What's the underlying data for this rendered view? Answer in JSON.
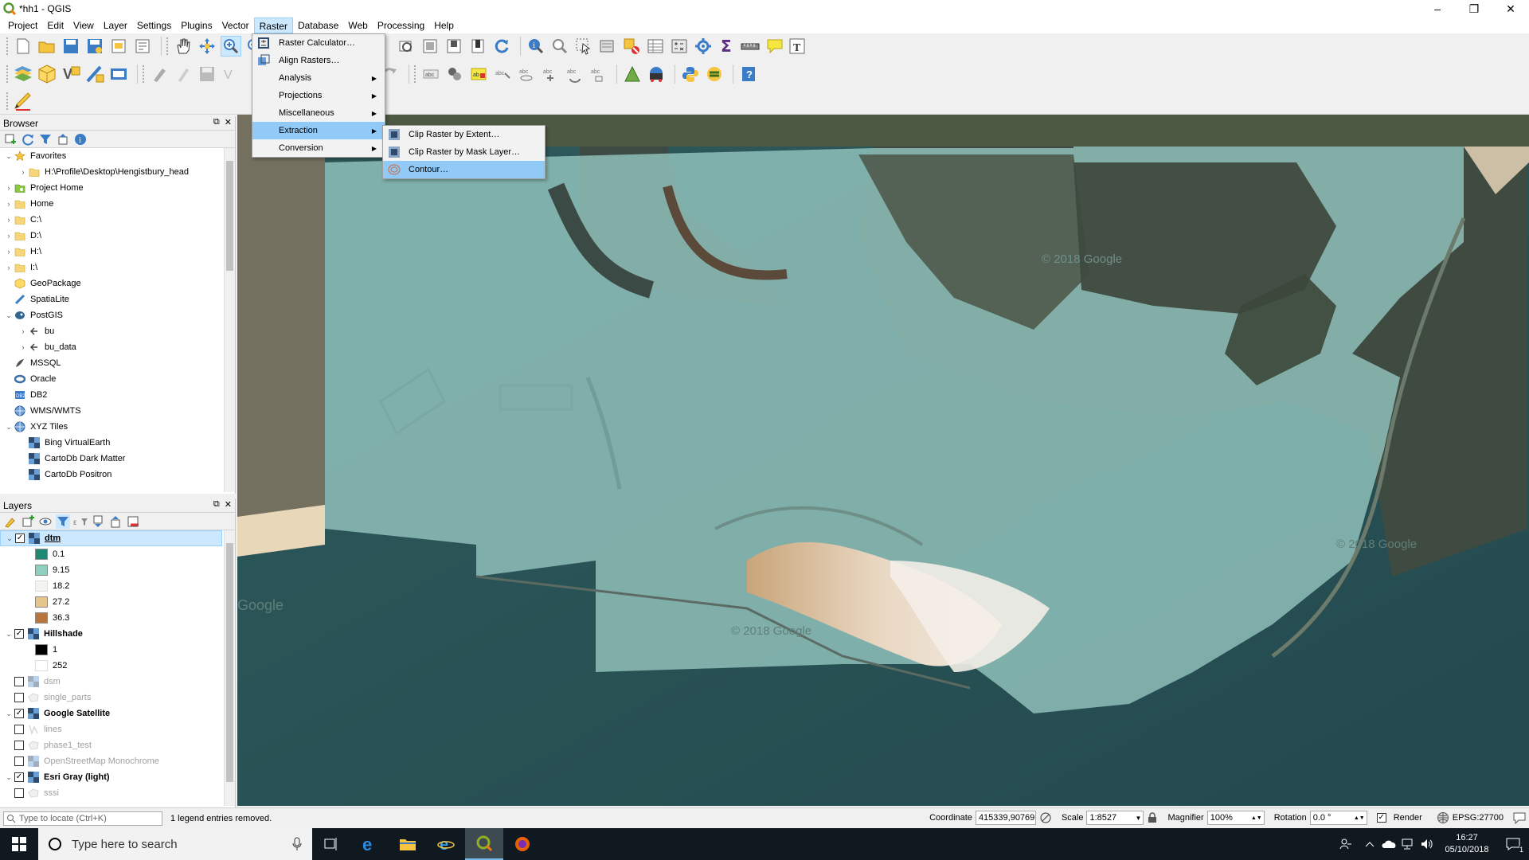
{
  "window": {
    "title": "*hh1 - QGIS",
    "minimize": "–",
    "restore": "❐",
    "close": "✕"
  },
  "menubar": [
    "Project",
    "Edit",
    "View",
    "Layer",
    "Settings",
    "Plugins",
    "Vector",
    "Raster",
    "Database",
    "Web",
    "Processing",
    "Help"
  ],
  "raster_menu": {
    "items": [
      {
        "label": "Raster Calculator…",
        "submenu": false
      },
      {
        "label": "Align Rasters…",
        "submenu": false
      },
      {
        "label": "Analysis",
        "submenu": true
      },
      {
        "label": "Projections",
        "submenu": true
      },
      {
        "label": "Miscellaneous",
        "submenu": true
      },
      {
        "label": "Extraction",
        "submenu": true
      },
      {
        "label": "Conversion",
        "submenu": true
      }
    ],
    "highlighted": "Extraction"
  },
  "extraction_submenu": {
    "items": [
      "Clip Raster by Extent…",
      "Clip Raster by Mask Layer…",
      "Contour…"
    ],
    "highlighted": "Contour…"
  },
  "browser": {
    "title": "Browser",
    "items": [
      {
        "label": "Favorites",
        "level": 0,
        "arrow": "⌄",
        "icon": "star-icon"
      },
      {
        "label": "H:\\Profile\\Desktop\\Hengistbury_head",
        "level": 1,
        "arrow": "›",
        "icon": "folder-icon"
      },
      {
        "label": "Project Home",
        "level": 0,
        "arrow": "›",
        "icon": "project-home-icon"
      },
      {
        "label": "Home",
        "level": 0,
        "arrow": "›",
        "icon": "folder-icon"
      },
      {
        "label": "C:\\",
        "level": 0,
        "arrow": "›",
        "icon": "folder-icon"
      },
      {
        "label": "D:\\",
        "level": 0,
        "arrow": "›",
        "icon": "folder-icon"
      },
      {
        "label": "H:\\",
        "level": 0,
        "arrow": "›",
        "icon": "folder-icon"
      },
      {
        "label": "I:\\",
        "level": 0,
        "arrow": "›",
        "icon": "folder-icon"
      },
      {
        "label": "GeoPackage",
        "level": 0,
        "arrow": "",
        "icon": "geopackage-icon"
      },
      {
        "label": "SpatiaLite",
        "level": 0,
        "arrow": "",
        "icon": "spatialite-icon"
      },
      {
        "label": "PostGIS",
        "level": 0,
        "arrow": "⌄",
        "icon": "postgis-icon"
      },
      {
        "label": "bu",
        "level": 1,
        "arrow": "›",
        "icon": "connection-icon"
      },
      {
        "label": "bu_data",
        "level": 1,
        "arrow": "›",
        "icon": "connection-icon"
      },
      {
        "label": "MSSQL",
        "level": 0,
        "arrow": "",
        "icon": "mssql-icon"
      },
      {
        "label": "Oracle",
        "level": 0,
        "arrow": "",
        "icon": "oracle-icon"
      },
      {
        "label": "DB2",
        "level": 0,
        "arrow": "",
        "icon": "db2-icon"
      },
      {
        "label": "WMS/WMTS",
        "level": 0,
        "arrow": "",
        "icon": "wms-icon"
      },
      {
        "label": "XYZ Tiles",
        "level": 0,
        "arrow": "⌄",
        "icon": "xyz-icon"
      },
      {
        "label": "Bing VirtualEarth",
        "level": 1,
        "arrow": "",
        "icon": "raster-layer-icon"
      },
      {
        "label": "CartoDb Dark Matter",
        "level": 1,
        "arrow": "",
        "icon": "raster-layer-icon"
      },
      {
        "label": "CartoDb Positron",
        "level": 1,
        "arrow": "",
        "icon": "raster-layer-icon"
      }
    ]
  },
  "layers": {
    "title": "Layers",
    "rows": [
      {
        "type": "layer",
        "label": "dtm",
        "checked": true,
        "expanded": true,
        "bold": true,
        "selected": true,
        "grey": false,
        "icon": "raster-layer-icon"
      },
      {
        "type": "legend",
        "label": "0.1",
        "color": "#1f8a74"
      },
      {
        "type": "legend",
        "label": "9.15",
        "color": "#8fcfc0"
      },
      {
        "type": "legend",
        "label": "18.2",
        "color": "#f3f3ef"
      },
      {
        "type": "legend",
        "label": "27.2",
        "color": "#e6c58a"
      },
      {
        "type": "legend",
        "label": "36.3",
        "color": "#b8763a"
      },
      {
        "type": "layer",
        "label": "Hillshade",
        "checked": true,
        "expanded": true,
        "bold": true,
        "grey": false,
        "icon": "raster-layer-icon"
      },
      {
        "type": "legend",
        "label": "1",
        "color": "#000000"
      },
      {
        "type": "legend",
        "label": "252",
        "color": "#ffffff"
      },
      {
        "type": "layer",
        "label": "dsm",
        "checked": false,
        "expanded": false,
        "bold": false,
        "grey": true,
        "icon": "raster-layer-icon"
      },
      {
        "type": "layer",
        "label": "single_parts",
        "checked": false,
        "expanded": false,
        "bold": false,
        "grey": true,
        "icon": "polygon-layer-icon"
      },
      {
        "type": "layer",
        "label": "Google Satellite",
        "checked": true,
        "expanded": true,
        "bold": true,
        "grey": false,
        "icon": "raster-layer-icon"
      },
      {
        "type": "layer",
        "label": "lines",
        "checked": false,
        "expanded": false,
        "bold": false,
        "grey": true,
        "icon": "line-layer-icon"
      },
      {
        "type": "layer",
        "label": "phase1_test",
        "checked": false,
        "expanded": false,
        "bold": false,
        "grey": true,
        "icon": "polygon-layer-icon"
      },
      {
        "type": "layer",
        "label": "OpenStreetMap Monochrome",
        "checked": false,
        "expanded": false,
        "bold": false,
        "grey": true,
        "icon": "raster-layer-icon"
      },
      {
        "type": "layer",
        "label": "Esri Gray (light)",
        "checked": true,
        "expanded": true,
        "bold": true,
        "grey": false,
        "icon": "raster-layer-icon"
      },
      {
        "type": "layer",
        "label": "sssi",
        "checked": false,
        "expanded": false,
        "bold": false,
        "grey": true,
        "icon": "polygon-layer-icon"
      }
    ]
  },
  "map": {
    "watermarks": [
      "© 2018 Google",
      "© 2018 Google",
      "© 2018 Google",
      "Google"
    ]
  },
  "statusbar": {
    "locate_placeholder": "Type to locate (Ctrl+K)",
    "message": "1 legend entries removed.",
    "coordinate_label": "Coordinate",
    "coordinate": "415339,90769",
    "scale_label": "Scale",
    "scale": "1:8527",
    "magnifier_label": "Magnifier",
    "magnifier": "100%",
    "rotation_label": "Rotation",
    "rotation": "0.0 °",
    "render_label": "Render",
    "crs": "EPSG:27700"
  },
  "taskbar": {
    "search_placeholder": "Type here to search",
    "time": "16:27",
    "date": "05/10/2018",
    "notification_count": "1"
  }
}
